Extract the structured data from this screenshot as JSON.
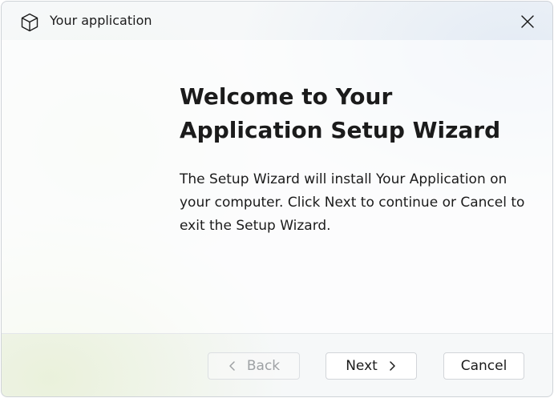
{
  "window": {
    "title": "Your application",
    "app_icon": "box-icon",
    "close_icon": "close-icon"
  },
  "content": {
    "heading": "Welcome to Your Application Setup Wizard",
    "body": "The Setup Wizard will install Your Application on your computer. Click Next to continue or Cancel to exit the Setup Wizard."
  },
  "footer": {
    "back_label": "Back",
    "back_icon": "chevron-left-icon",
    "back_enabled": false,
    "next_label": "Next",
    "next_icon": "chevron-right-icon",
    "cancel_label": "Cancel"
  },
  "colors": {
    "text": "#1b1b1b",
    "disabled_text": "#9ea1a4",
    "border": "#d2d5d9"
  }
}
